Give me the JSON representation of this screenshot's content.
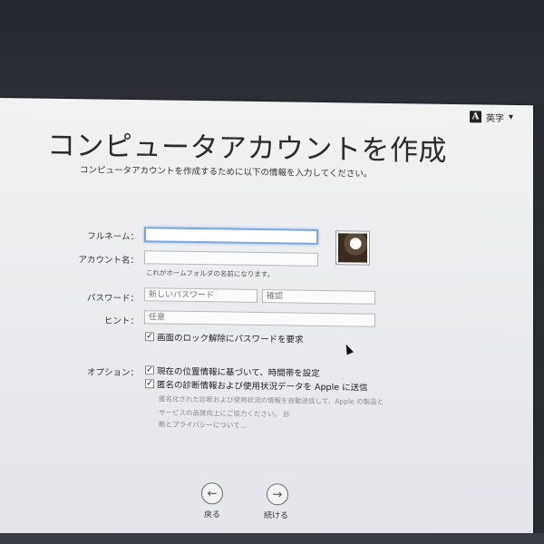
{
  "input_menu": {
    "icon_letter": "A",
    "label": "英字",
    "caret": "▾"
  },
  "title": "コンピュータアカウントを作成",
  "subtitle": "コンピュータアカウントを作成するために以下の情報を入力してください。",
  "form": {
    "fullname": {
      "label": "フルネーム：",
      "value": "",
      "placeholder": ""
    },
    "account": {
      "label": "アカウント名：",
      "value": "",
      "placeholder": "",
      "note": "これがホームフォルダの名前になります。"
    },
    "password": {
      "label": "パスワード：",
      "placeholder": "新しいパスワード",
      "confirm_placeholder": "確認"
    },
    "hint": {
      "label": "ヒント：",
      "placeholder": "任意"
    },
    "lock_checkbox": {
      "label": "画面のロック解除にパスワードを要求",
      "checked": true
    }
  },
  "options": {
    "label": "オプション：",
    "timezone": {
      "label": "現在の位置情報に基づいて、時間帯を設定",
      "checked": true
    },
    "diagnostics": {
      "label": "匿名の診断情報および使用状況データを Apple に送信",
      "checked": true
    },
    "privacy_text": "匿名化された診断および使用状況の情報を自動送信して、Apple の製品とサービスの品質向上にご協力ください。 診",
    "privacy_link": "断とプライバシーについて..."
  },
  "nav": {
    "back": {
      "label": "戻る",
      "icon": "left-arrow-icon",
      "glyph": "←"
    },
    "continue": {
      "label": "続ける",
      "icon": "right-arrow-icon",
      "glyph": "→"
    }
  },
  "checkmark": "✓"
}
